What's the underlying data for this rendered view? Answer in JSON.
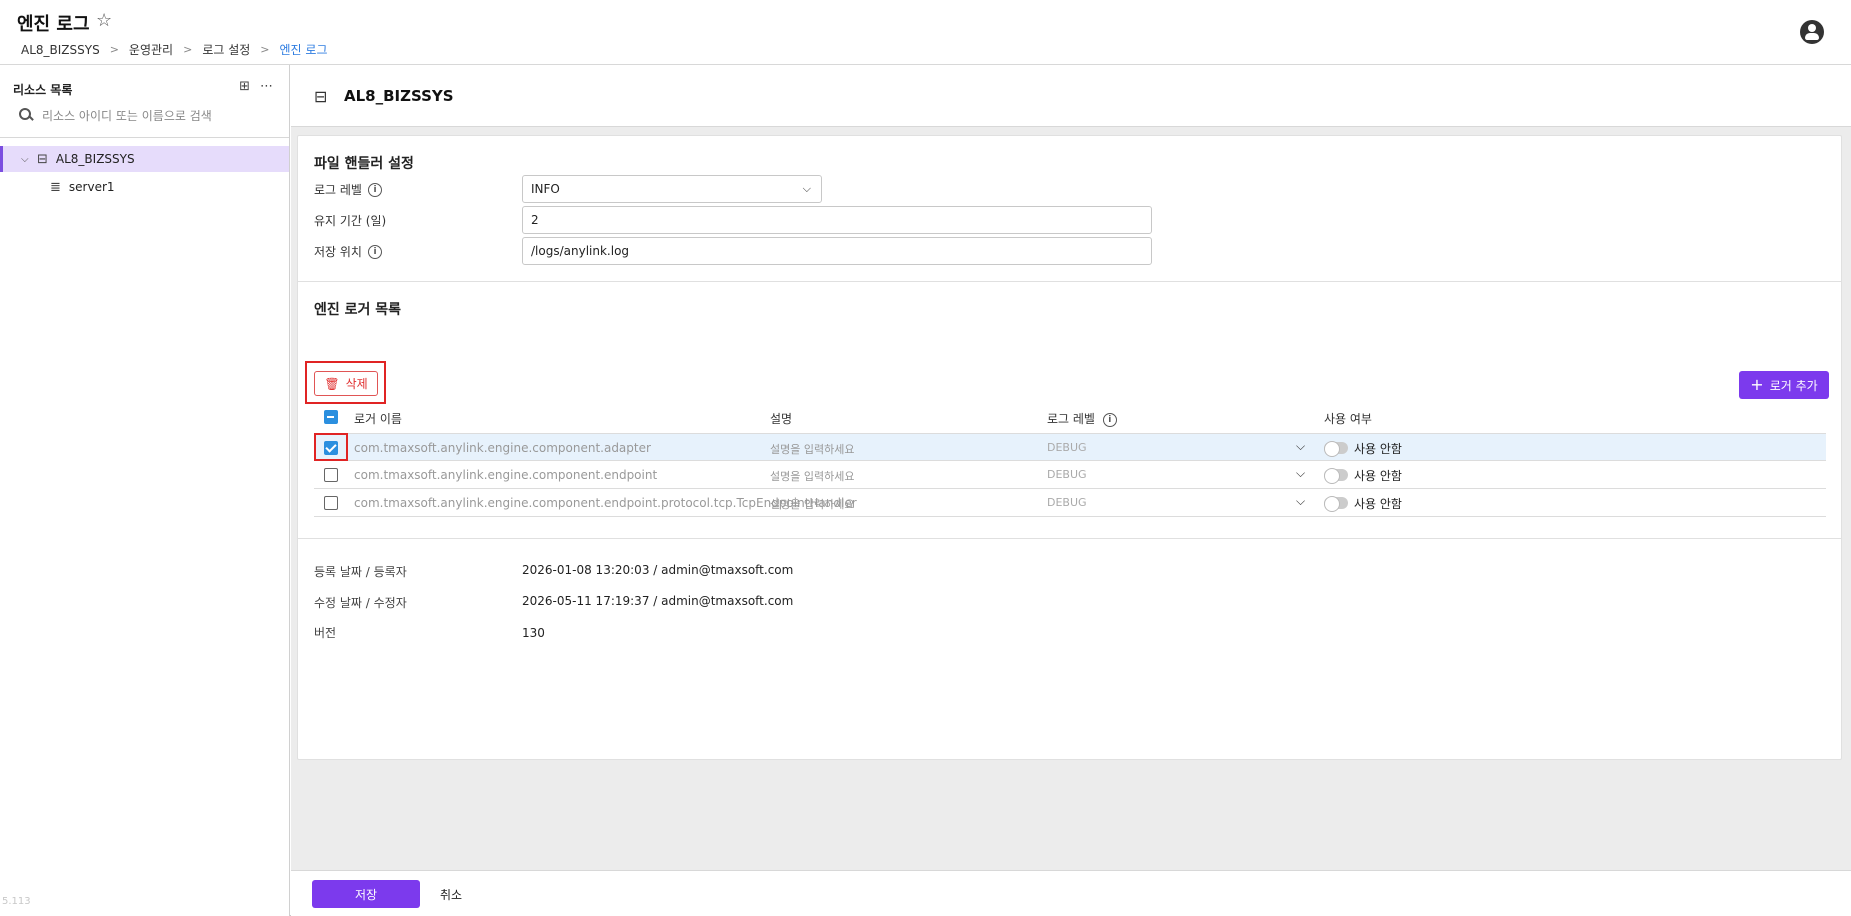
{
  "header": {
    "title": "엔진 로그",
    "breadcrumb": [
      "AL8_BIZSSYS",
      "운영관리",
      "로그 설정",
      "엔진 로그"
    ]
  },
  "sidebar": {
    "title": "리소스 목록",
    "search_placeholder": "리소스 아이디 또는 이름으로 검색",
    "tree": {
      "root": "AL8_BIZSSYS",
      "children": [
        "server1"
      ]
    }
  },
  "resource": {
    "title": "AL8_BIZSSYS"
  },
  "file_handler": {
    "section_title": "파일 핸들러 설정",
    "log_level_label": "로그 레벨",
    "log_level_value": "INFO",
    "retention_label": "유지 기간 (일)",
    "retention_value": "2",
    "location_label": "저장 위치",
    "location_value": "/logs/anylink.log"
  },
  "loggers": {
    "section_title": "엔진 로거 목록",
    "delete_label": "삭제",
    "add_label": "로거 추가",
    "columns": {
      "name": "로거 이름",
      "description": "설명",
      "level": "로그 레벨",
      "enabled": "사용 여부"
    },
    "rows": [
      {
        "name": "com.tmaxsoft.anylink.engine.component.adapter",
        "description": "설명을 입력하세요",
        "level": "DEBUG",
        "enabled": "사용 안함"
      },
      {
        "name": "com.tmaxsoft.anylink.engine.component.endpoint",
        "description": "설명을 입력하세요",
        "level": "DEBUG",
        "enabled": "사용 안함"
      },
      {
        "name": "com.tmaxsoft.anylink.engine.component.endpoint.protocol.tcp.TcpEndpointHandler",
        "description": "설명을 입력하세요",
        "level": "DEBUG",
        "enabled": "사용 안함"
      }
    ]
  },
  "meta": {
    "registered_label": "등록 날짜 / 등록자",
    "registered_value": "2026-01-08 13:20:03 / admin@tmaxsoft.com",
    "modified_label": "수정 날짜 / 수정자",
    "modified_value": "2026-05-11 17:19:37 / admin@tmaxsoft.com",
    "version_label": "버전",
    "version_value": "130"
  },
  "footer": {
    "save_label": "저장",
    "cancel_label": "취소"
  },
  "app_version": "5.113",
  "colors": {
    "accent": "#7c3aed",
    "selected_row": "#e7f2fc",
    "tree_selected": "#e6dcfb",
    "danger": "#e03030",
    "link": "#2f7de1"
  }
}
